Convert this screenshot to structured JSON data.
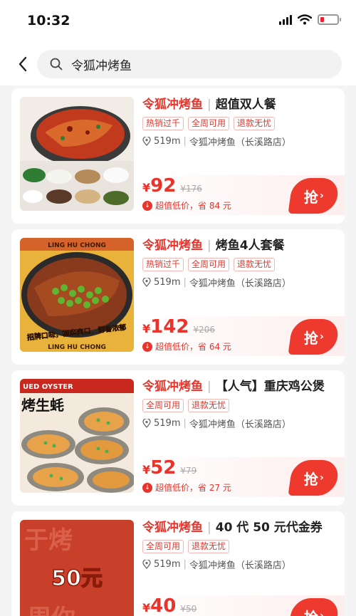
{
  "status": {
    "time": "10:32"
  },
  "search": {
    "query": "令狐冲烤鱼"
  },
  "products": [
    {
      "brand": "令狐冲烤鱼",
      "name": "超值双人餐",
      "tags": [
        "热销过千",
        "全周可用",
        "退款无忧"
      ],
      "distance": "519m",
      "store": "令狐冲烤鱼（长溪路店）",
      "currency": "¥",
      "price": "92",
      "original": "¥176",
      "saving": "超值低价，省 84 元",
      "cta": "抢",
      "thumb_overlay": ""
    },
    {
      "brand": "令狐冲烤鱼",
      "name": "烤鱼4人套餐",
      "tags": [
        "热销过千",
        "全周可用",
        "退款无忧"
      ],
      "distance": "519m",
      "store": "令狐冲烤鱼（长溪路店）",
      "currency": "¥",
      "price": "142",
      "original": "¥206",
      "saving": "超值低价，省 64 元",
      "cta": "抢",
      "thumb_overlay": "招牌口味，椒麻爽口，鲜香浓郁"
    },
    {
      "brand": "令狐冲烤鱼",
      "name": "【人气】重庆鸡公煲",
      "tags": [
        "全周可用",
        "退款无忧"
      ],
      "distance": "519m",
      "store": "令狐冲烤鱼（长溪路店）",
      "currency": "¥",
      "price": "52",
      "original": "¥79",
      "saving": "超值低价，省 27 元",
      "cta": "抢",
      "thumb_overlay": "烤生蚝"
    },
    {
      "brand": "令狐冲烤鱼",
      "name": "40 代 50 元代金券",
      "tags": [
        "全周可用",
        "退款无忧"
      ],
      "distance": "519m",
      "store": "令狐冲烤鱼（长溪路店）",
      "currency": "¥",
      "price": "40",
      "original": "¥50",
      "saving": "",
      "cta": "抢",
      "thumb_overlay": "50元"
    }
  ],
  "thumb_banners": {
    "p2_top": "LING HU CHONG",
    "p2_bottom": "LING HU CHONG",
    "p3_top": "UED OYSTER"
  },
  "colors": {
    "accent": "#e8342a",
    "button": "#ee3a2e"
  },
  "icons": {
    "back": "chevron-left-icon",
    "search": "search-icon",
    "location": "location-pin-icon",
    "saving": "down-arrow-circle-icon"
  }
}
